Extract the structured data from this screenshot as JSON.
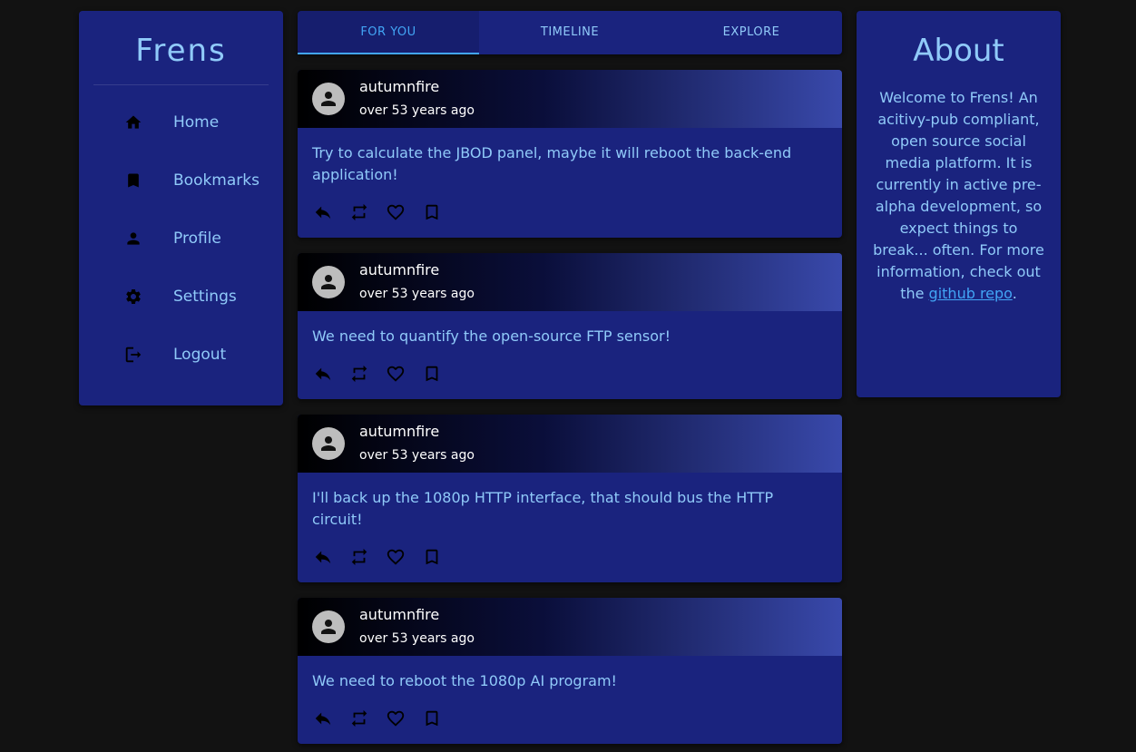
{
  "sidebar": {
    "brand": "Frens",
    "items": [
      {
        "label": "Home",
        "icon": "home-icon"
      },
      {
        "label": "Bookmarks",
        "icon": "bookmark-icon"
      },
      {
        "label": "Profile",
        "icon": "person-icon"
      },
      {
        "label": "Settings",
        "icon": "gear-icon"
      },
      {
        "label": "Logout",
        "icon": "logout-icon"
      }
    ]
  },
  "tabs": [
    {
      "label": "FOR YOU",
      "active": true
    },
    {
      "label": "TIMELINE",
      "active": false
    },
    {
      "label": "EXPLORE",
      "active": false
    }
  ],
  "posts": [
    {
      "username": "autumnfire",
      "time": "over 53 years ago",
      "body": "Try to calculate the JBOD panel, maybe it will reboot the back-end application!"
    },
    {
      "username": "autumnfire",
      "time": "over 53 years ago",
      "body": "We need to quantify the open-source FTP sensor!"
    },
    {
      "username": "autumnfire",
      "time": "over 53 years ago",
      "body": "I'll back up the 1080p HTTP interface, that should bus the HTTP circuit!"
    },
    {
      "username": "autumnfire",
      "time": "over 53 years ago",
      "body": "We need to reboot the 1080p AI program!"
    }
  ],
  "post_actions": [
    "reply-icon",
    "repost-icon",
    "heart-icon",
    "bookmark-outline-icon"
  ],
  "about": {
    "title": "About",
    "text": "Welcome to Frens! An acitivy-pub compliant, open source social media platform. It is currently in active pre-alpha development, so expect things to break... often. For more information, check out the",
    "link_text": "github repo",
    "after_link": "."
  },
  "colors": {
    "background": "#121212",
    "panel": "#1a237e",
    "accent": "#90caf9",
    "active_tab": "#42a5f5"
  }
}
